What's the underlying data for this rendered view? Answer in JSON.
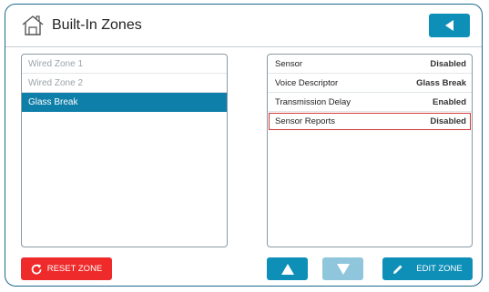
{
  "header": {
    "title": "Built-In Zones",
    "icon": "home-icon",
    "back_icon": "back-arrow-icon"
  },
  "zones": [
    {
      "label": "Wired Zone 1",
      "state": "disabled"
    },
    {
      "label": "Wired Zone 2",
      "state": "disabled"
    },
    {
      "label": "Glass Break",
      "state": "selected"
    }
  ],
  "details": [
    {
      "label": "Sensor",
      "value": "Disabled"
    },
    {
      "label": "Voice Descriptor",
      "value": "Glass Break"
    },
    {
      "label": "Transmission Delay",
      "value": "Enabled"
    },
    {
      "label": "Sensor Reports",
      "value": "Disabled",
      "highlighted": true
    }
  ],
  "buttons": {
    "reset_label": "RESET ZONE",
    "edit_label": "EDIT ZONE",
    "up_icon": "up-arrow-icon",
    "down_icon": "down-arrow-icon"
  },
  "colors": {
    "accent": "#0e8fb8",
    "selected": "#0e7fa8",
    "danger": "#ee2a2a",
    "highlight_border": "#d23a3a",
    "disabled_button": "#8fc6dc"
  }
}
